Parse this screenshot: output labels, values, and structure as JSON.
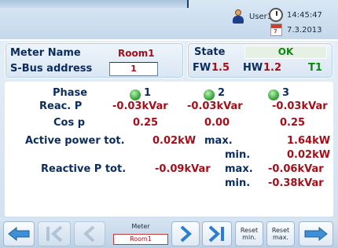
{
  "header": {
    "user": "User1",
    "time": "14:45:47",
    "date": "7.3.2013"
  },
  "meter_panel": {
    "meter_name_label": "Meter Name",
    "meter_name_value": "Room1",
    "sbus_label": "S-Bus address",
    "sbus_value": "1"
  },
  "state_panel": {
    "state_label": "State",
    "state_value": "OK",
    "fw_label": "FW",
    "fw_value": "1.5",
    "hw_label": "HW",
    "hw_value": "1.2",
    "t_value": "T1"
  },
  "measurements": {
    "phase_label": "Phase",
    "phases": [
      "1",
      "2",
      "3"
    ],
    "reac_label": "Reac. P",
    "reac_values": [
      "-0.03kVar",
      "-0.03kVar",
      "-0.03kVar"
    ],
    "cos_label": "Cos p",
    "cos_values": [
      "0.25",
      "0.00",
      "0.25"
    ],
    "active_label": "Active power tot.",
    "active_value": "0.02kW",
    "active_max_label": "max.",
    "active_max_value": "1.64kW",
    "active_min_label": "min.",
    "active_min_value": "0.02kW",
    "reactive_label": "Reactive P tot.",
    "reactive_value": "-0.09kVar",
    "reactive_max_label": "max.",
    "reactive_max_value": "-0.06kVar",
    "reactive_min_label": "min.",
    "reactive_min_value": "-0.38kVar"
  },
  "toolbar": {
    "meter_label": "Meter",
    "meter_value": "Room1",
    "reset_min_top": "Reset",
    "reset_min_bottom": "min.",
    "reset_max_top": "Reset",
    "reset_max_bottom": "max."
  },
  "icons": {
    "back": "arrow-left-icon",
    "first": "first-page-icon",
    "prev": "chevron-left-icon",
    "next": "chevron-right-icon",
    "last": "last-page-icon",
    "forward": "arrow-right-icon"
  },
  "colors": {
    "label_navy": "#0c2c5c",
    "value_red": "#a3101a",
    "ok_green": "#0a8a0a"
  }
}
